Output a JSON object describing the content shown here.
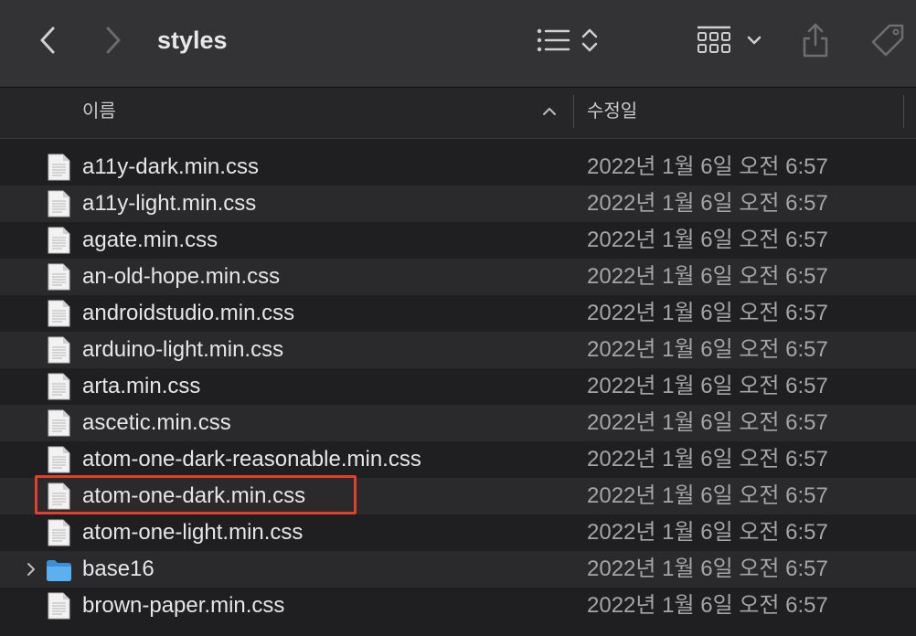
{
  "window": {
    "title": "styles"
  },
  "columns": {
    "name": "이름",
    "modified": "수정일"
  },
  "rows": [
    {
      "name": "a11y-dark.min.css",
      "date": "2022년 1월 6일 오전 6:57",
      "kind": "file"
    },
    {
      "name": "a11y-light.min.css",
      "date": "2022년 1월 6일 오전 6:57",
      "kind": "file"
    },
    {
      "name": "agate.min.css",
      "date": "2022년 1월 6일 오전 6:57",
      "kind": "file"
    },
    {
      "name": "an-old-hope.min.css",
      "date": "2022년 1월 6일 오전 6:57",
      "kind": "file"
    },
    {
      "name": "androidstudio.min.css",
      "date": "2022년 1월 6일 오전 6:57",
      "kind": "file"
    },
    {
      "name": "arduino-light.min.css",
      "date": "2022년 1월 6일 오전 6:57",
      "kind": "file"
    },
    {
      "name": "arta.min.css",
      "date": "2022년 1월 6일 오전 6:57",
      "kind": "file"
    },
    {
      "name": "ascetic.min.css",
      "date": "2022년 1월 6일 오전 6:57",
      "kind": "file"
    },
    {
      "name": "atom-one-dark-reasonable.min.css",
      "date": "2022년 1월 6일 오전 6:57",
      "kind": "file"
    },
    {
      "name": "atom-one-dark.min.css",
      "date": "2022년 1월 6일 오전 6:57",
      "kind": "file",
      "highlighted": true
    },
    {
      "name": "atom-one-light.min.css",
      "date": "2022년 1월 6일 오전 6:57",
      "kind": "file"
    },
    {
      "name": "base16",
      "date": "2022년 1월 6일 오전 6:57",
      "kind": "folder"
    },
    {
      "name": "brown-paper.min.css",
      "date": "2022년 1월 6일 오전 6:57",
      "kind": "file"
    }
  ],
  "icons": {
    "back": "chevron-left-icon",
    "forward": "chevron-right-icon",
    "list_view": "list-view-icon",
    "sort_toggle": "up-down-chevron-icon",
    "group": "grid-group-icon",
    "group_menu": "chevron-down-icon",
    "share": "share-icon",
    "tag": "tag-icon",
    "file": "document-icon",
    "folder": "folder-icon"
  },
  "colors": {
    "highlight_border": "#e0402c",
    "folder": "#4aa3e8"
  }
}
